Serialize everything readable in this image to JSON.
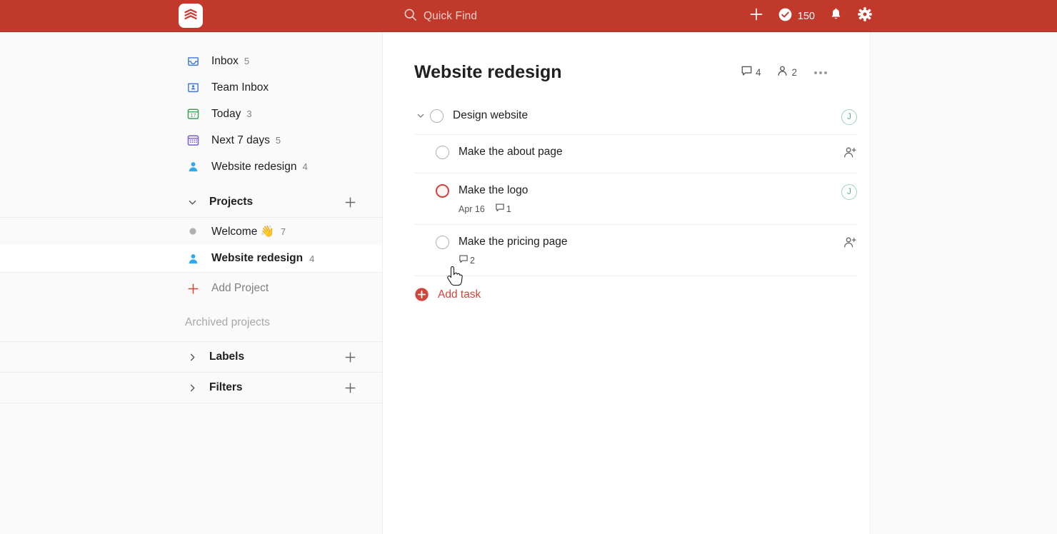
{
  "app": {
    "name": "Todoist",
    "logo_icon": "todoist-logo-icon"
  },
  "topbar": {
    "search": {
      "placeholder": "Quick Find",
      "icon": "search-icon"
    },
    "add_icon": "plus-icon",
    "karma": {
      "icon": "check-circle-icon",
      "count": "150"
    },
    "notifications_icon": "bell-icon",
    "settings_icon": "gear-icon",
    "accent_color": "#c0392b"
  },
  "sidebar": {
    "nav": [
      {
        "label": "Inbox",
        "count": "5",
        "icon": "inbox-icon"
      },
      {
        "label": "Team Inbox",
        "count": "",
        "icon": "team-inbox-icon"
      },
      {
        "label": "Today",
        "count": "3",
        "icon": "calendar-today-icon"
      },
      {
        "label": "Next 7 days",
        "count": "5",
        "icon": "calendar-week-icon"
      },
      {
        "label": "Website redesign",
        "count": "4",
        "icon": "person-icon"
      }
    ],
    "projects_section": {
      "title": "Projects",
      "chevron_icon": "chevron-down-icon",
      "add_icon": "plus-icon",
      "items": [
        {
          "label": "Welcome 👋",
          "count": "7",
          "icon": "project-dot-icon",
          "selected": false
        },
        {
          "label": "Website redesign",
          "count": "4",
          "icon": "person-icon",
          "selected": true
        }
      ],
      "add_project_label": "Add Project",
      "add_project_icon": "plus-icon",
      "archived_label": "Archived projects"
    },
    "labels_section": {
      "title": "Labels",
      "chevron_icon": "chevron-right-icon",
      "add_icon": "plus-icon"
    },
    "filters_section": {
      "title": "Filters",
      "chevron_icon": "chevron-right-icon",
      "add_icon": "plus-icon"
    }
  },
  "main": {
    "project_title": "Website redesign",
    "comment_count": "4",
    "comment_icon": "comment-icon",
    "collaborator_count": "2",
    "collaborator_icon": "person-icon",
    "more_icon": "more-options-icon",
    "tasks": [
      {
        "title": "Design website",
        "level": "parent",
        "priority": "p4",
        "chevron_icon": "chevron-down-icon",
        "date": "",
        "comments": "",
        "assignee_initial": "J",
        "right_icon": "avatar"
      },
      {
        "title": "Make the about page",
        "level": "child",
        "priority": "p4",
        "date": "",
        "comments": "",
        "assignee_initial": "",
        "right_icon": "assign-person-icon"
      },
      {
        "title": "Make the logo",
        "level": "child",
        "priority": "p1",
        "date": "Apr 16",
        "comments": "1",
        "assignee_initial": "J",
        "right_icon": "avatar"
      },
      {
        "title": "Make the pricing page",
        "level": "child",
        "priority": "p4",
        "date": "",
        "comments": "2",
        "assignee_initial": "",
        "right_icon": "assign-person-icon"
      }
    ],
    "add_task_label": "Add task",
    "add_task_icon": "plus-circle-icon"
  }
}
